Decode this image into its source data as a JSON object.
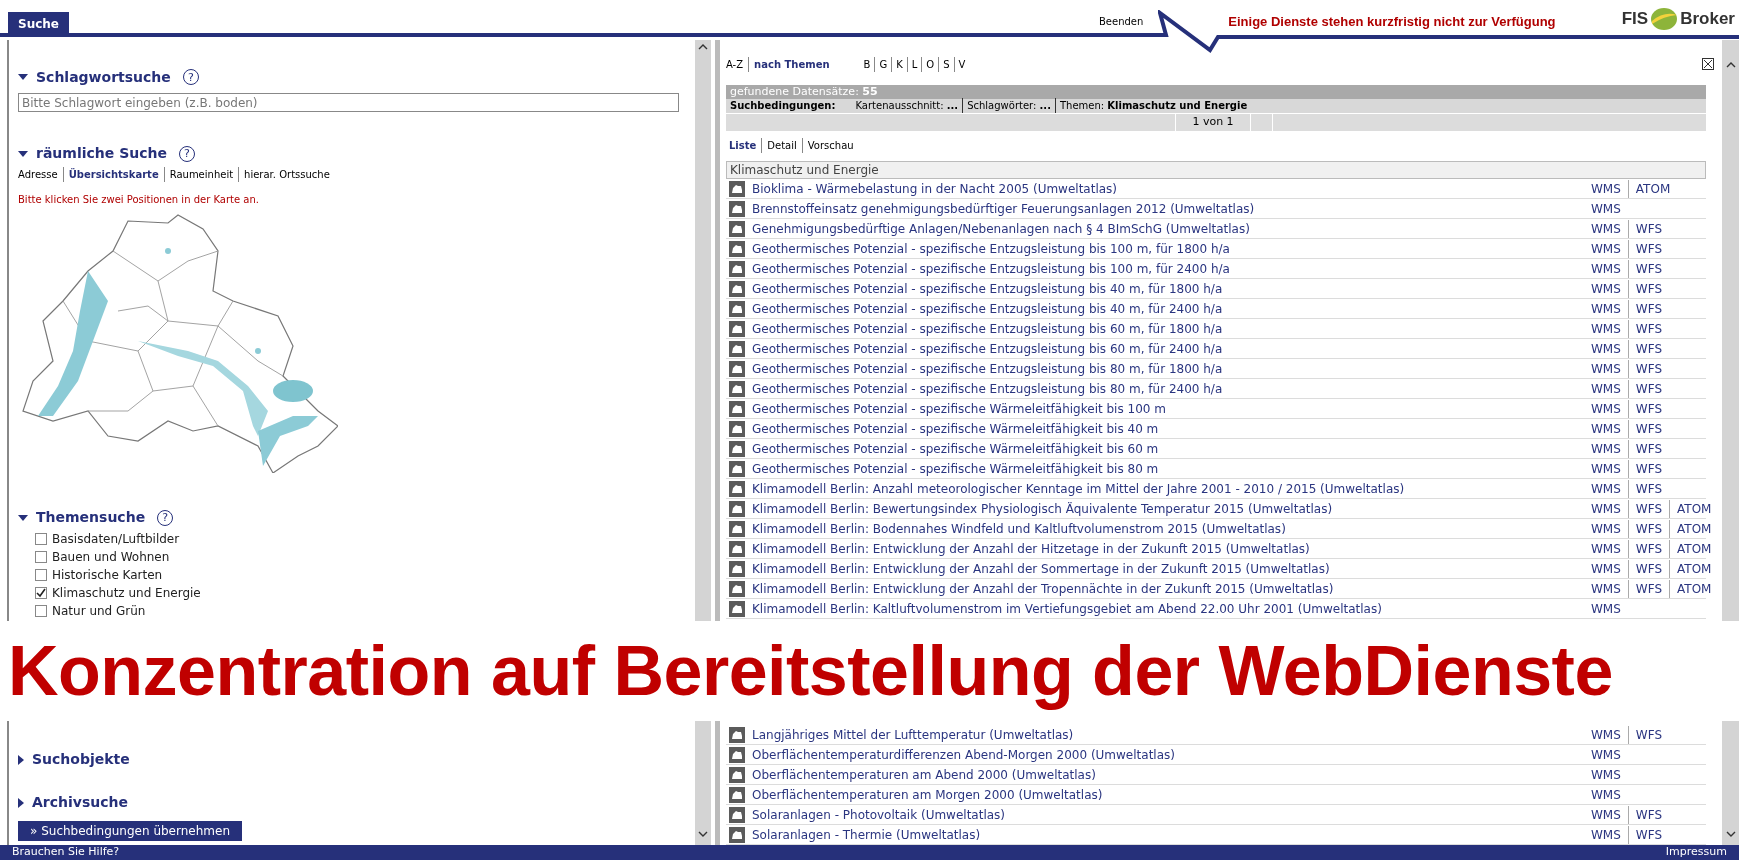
{
  "header": {
    "tabs": [
      {
        "label": "Suche",
        "selected": true
      }
    ],
    "exit_link": "Beenden",
    "notice": "Einige Dienste stehen kurzfristig nicht zur Verfügung",
    "logo": {
      "left": "FIS",
      "right": "Broker"
    }
  },
  "left_panel": {
    "sections": [
      {
        "kind": "keyword",
        "title": "Schlagwortsuche",
        "expanded": true,
        "help": "?",
        "placeholder": "Bitte Schlagwort eingeben (z.B. boden)"
      },
      {
        "kind": "spatial",
        "title": "räumliche Suche",
        "expanded": true,
        "help": "?",
        "links": [
          {
            "label": "Adresse",
            "selected": false
          },
          {
            "label": "Übersichtskarte",
            "selected": true
          },
          {
            "label": "Raumeinheit",
            "selected": false
          },
          {
            "label": "hierar. Ortssuche",
            "selected": false
          }
        ],
        "hint": "Bitte klicken Sie zwei Positionen in der Karte an.",
        "map": {
          "kind": "picture"
        }
      },
      {
        "kind": "themes",
        "title": "Themensuche",
        "expanded": true,
        "help": "?",
        "options": [
          {
            "label": "Basisdaten/Luftbilder",
            "checked": false
          },
          {
            "label": "Bauen und Wohnen",
            "checked": false
          },
          {
            "label": "Historische Karten",
            "checked": false
          },
          {
            "label": "Klimaschutz und Energie",
            "checked": true
          },
          {
            "label": "Natur und Grün",
            "checked": false
          }
        ]
      },
      {
        "kind": "collapsed",
        "title": "Suchobjekte",
        "expanded": false
      },
      {
        "kind": "collapsed",
        "title": "Archivsuche",
        "expanded": false
      }
    ],
    "apply_button": "» Suchbedingungen übernehmen"
  },
  "right_panel": {
    "index_tabs": [
      {
        "label": "A-Z",
        "selected": false
      },
      {
        "label": "nach Themen",
        "selected": true
      }
    ],
    "letters": [
      "B",
      "G",
      "K",
      "L",
      "O",
      "S",
      "V"
    ],
    "found": "gefundene Datensätze: **55**",
    "conditions_label": "Suchbedingungen:",
    "conditions": [
      "Kartenausschnitt: **...**",
      "Schlagwörter: **...**",
      "Themen: **Klimaschutz und Energie**"
    ],
    "pagination": "1 von 1",
    "views": [
      {
        "label": "Liste",
        "selected": true
      },
      {
        "label": "Detail",
        "selected": false
      },
      {
        "label": "Vorschau",
        "selected": false
      }
    ],
    "group": "Klimaschutz und Energie",
    "rows_top": [
      {
        "title": "Bioklima - Wärmebelastung in der Nacht 2005 (Umweltatlas)",
        "services": [
          "WMS",
          "ATOM"
        ]
      },
      {
        "title": "Brennstoffeinsatz genehmigungsbedürftiger Feuerungsanlagen 2012 (Umweltatlas)",
        "services": [
          "WMS"
        ]
      },
      {
        "title": "Genehmigungsbedürftige Anlagen/Nebenanlagen nach § 4 BImSchG (Umweltatlas)",
        "services": [
          "WMS",
          "WFS"
        ]
      },
      {
        "title": "Geothermisches Potenzial - spezifische Entzugsleistung bis 100 m, für 1800 h/a",
        "services": [
          "WMS",
          "WFS"
        ]
      },
      {
        "title": "Geothermisches Potenzial - spezifische Entzugsleistung bis 100 m, für 2400 h/a",
        "services": [
          "WMS",
          "WFS"
        ]
      },
      {
        "title": "Geothermisches Potenzial - spezifische Entzugsleistung bis 40 m, für 1800 h/a",
        "services": [
          "WMS",
          "WFS"
        ]
      },
      {
        "title": "Geothermisches Potenzial - spezifische Entzugsleistung bis 40 m, für 2400 h/a",
        "services": [
          "WMS",
          "WFS"
        ]
      },
      {
        "title": "Geothermisches Potenzial - spezifische Entzugsleistung bis 60 m, für 1800 h/a",
        "services": [
          "WMS",
          "WFS"
        ]
      },
      {
        "title": "Geothermisches Potenzial - spezifische Entzugsleistung bis 60 m, für 2400 h/a",
        "services": [
          "WMS",
          "WFS"
        ]
      },
      {
        "title": "Geothermisches Potenzial - spezifische Entzugsleistung bis 80 m, für 1800 h/a",
        "services": [
          "WMS",
          "WFS"
        ]
      },
      {
        "title": "Geothermisches Potenzial - spezifische Entzugsleistung bis 80 m, für 2400 h/a",
        "services": [
          "WMS",
          "WFS"
        ]
      },
      {
        "title": "Geothermisches Potenzial - spezifische Wärmeleitfähigkeit bis 100 m",
        "services": [
          "WMS",
          "WFS"
        ]
      },
      {
        "title": "Geothermisches Potenzial - spezifische Wärmeleitfähigkeit bis 40 m",
        "services": [
          "WMS",
          "WFS"
        ]
      },
      {
        "title": "Geothermisches Potenzial - spezifische Wärmeleitfähigkeit bis 60 m",
        "services": [
          "WMS",
          "WFS"
        ]
      },
      {
        "title": "Geothermisches Potenzial - spezifische Wärmeleitfähigkeit bis 80 m",
        "services": [
          "WMS",
          "WFS"
        ]
      },
      {
        "title": "Klimamodell Berlin: Anzahl meteorologischer Kenntage im Mittel der Jahre 2001 - 2010 / 2015 (Umweltatlas)",
        "services": [
          "WMS",
          "WFS"
        ]
      },
      {
        "title": "Klimamodell Berlin: Bewertungsindex Physiologisch Äquivalente Temperatur 2015 (Umweltatlas)",
        "services": [
          "WMS",
          "WFS",
          "ATOM"
        ]
      },
      {
        "title": "Klimamodell Berlin: Bodennahes Windfeld und Kaltluftvolumenstrom 2015 (Umweltatlas)",
        "services": [
          "WMS",
          "WFS",
          "ATOM"
        ]
      },
      {
        "title": "Klimamodell Berlin: Entwicklung der Anzahl der Hitzetage in der Zukunft 2015 (Umweltatlas)",
        "services": [
          "WMS",
          "WFS",
          "ATOM"
        ]
      },
      {
        "title": "Klimamodell Berlin: Entwicklung der Anzahl der Sommertage in der Zukunft 2015 (Umweltatlas)",
        "services": [
          "WMS",
          "WFS",
          "ATOM"
        ]
      },
      {
        "title": "Klimamodell Berlin: Entwicklung der Anzahl der Tropennächte in der Zukunft 2015 (Umweltatlas)",
        "services": [
          "WMS",
          "WFS",
          "ATOM"
        ]
      },
      {
        "title": "Klimamodell Berlin: Kaltluftvolumenstrom im Vertiefungsgebiet am Abend 22.00 Uhr 2001 (Umweltatlas)",
        "services": [
          "WMS"
        ]
      }
    ],
    "rows_bottom": [
      {
        "title": "Langjähriges Mittel der Lufttemperatur (Umweltatlas)",
        "services": [
          "WMS",
          "WFS"
        ]
      },
      {
        "title": "Oberflächentemperaturdifferenzen Abend-Morgen 2000 (Umweltatlas)",
        "services": [
          "WMS"
        ]
      },
      {
        "title": "Oberflächentemperaturen am Abend 2000 (Umweltatlas)",
        "services": [
          "WMS"
        ]
      },
      {
        "title": "Oberflächentemperaturen am Morgen 2000 (Umweltatlas)",
        "services": [
          "WMS"
        ]
      },
      {
        "title": "Solaranlagen - Photovoltaik (Umweltatlas)",
        "services": [
          "WMS",
          "WFS"
        ]
      },
      {
        "title": "Solaranlagen - Thermie (Umweltatlas)",
        "services": [
          "WMS",
          "WFS"
        ]
      }
    ]
  },
  "banner": "Konzentration auf Bereitstellung der WebDienste",
  "footer": {
    "help": "Brauchen Sie Hilfe?",
    "imprint": "Impressum"
  }
}
